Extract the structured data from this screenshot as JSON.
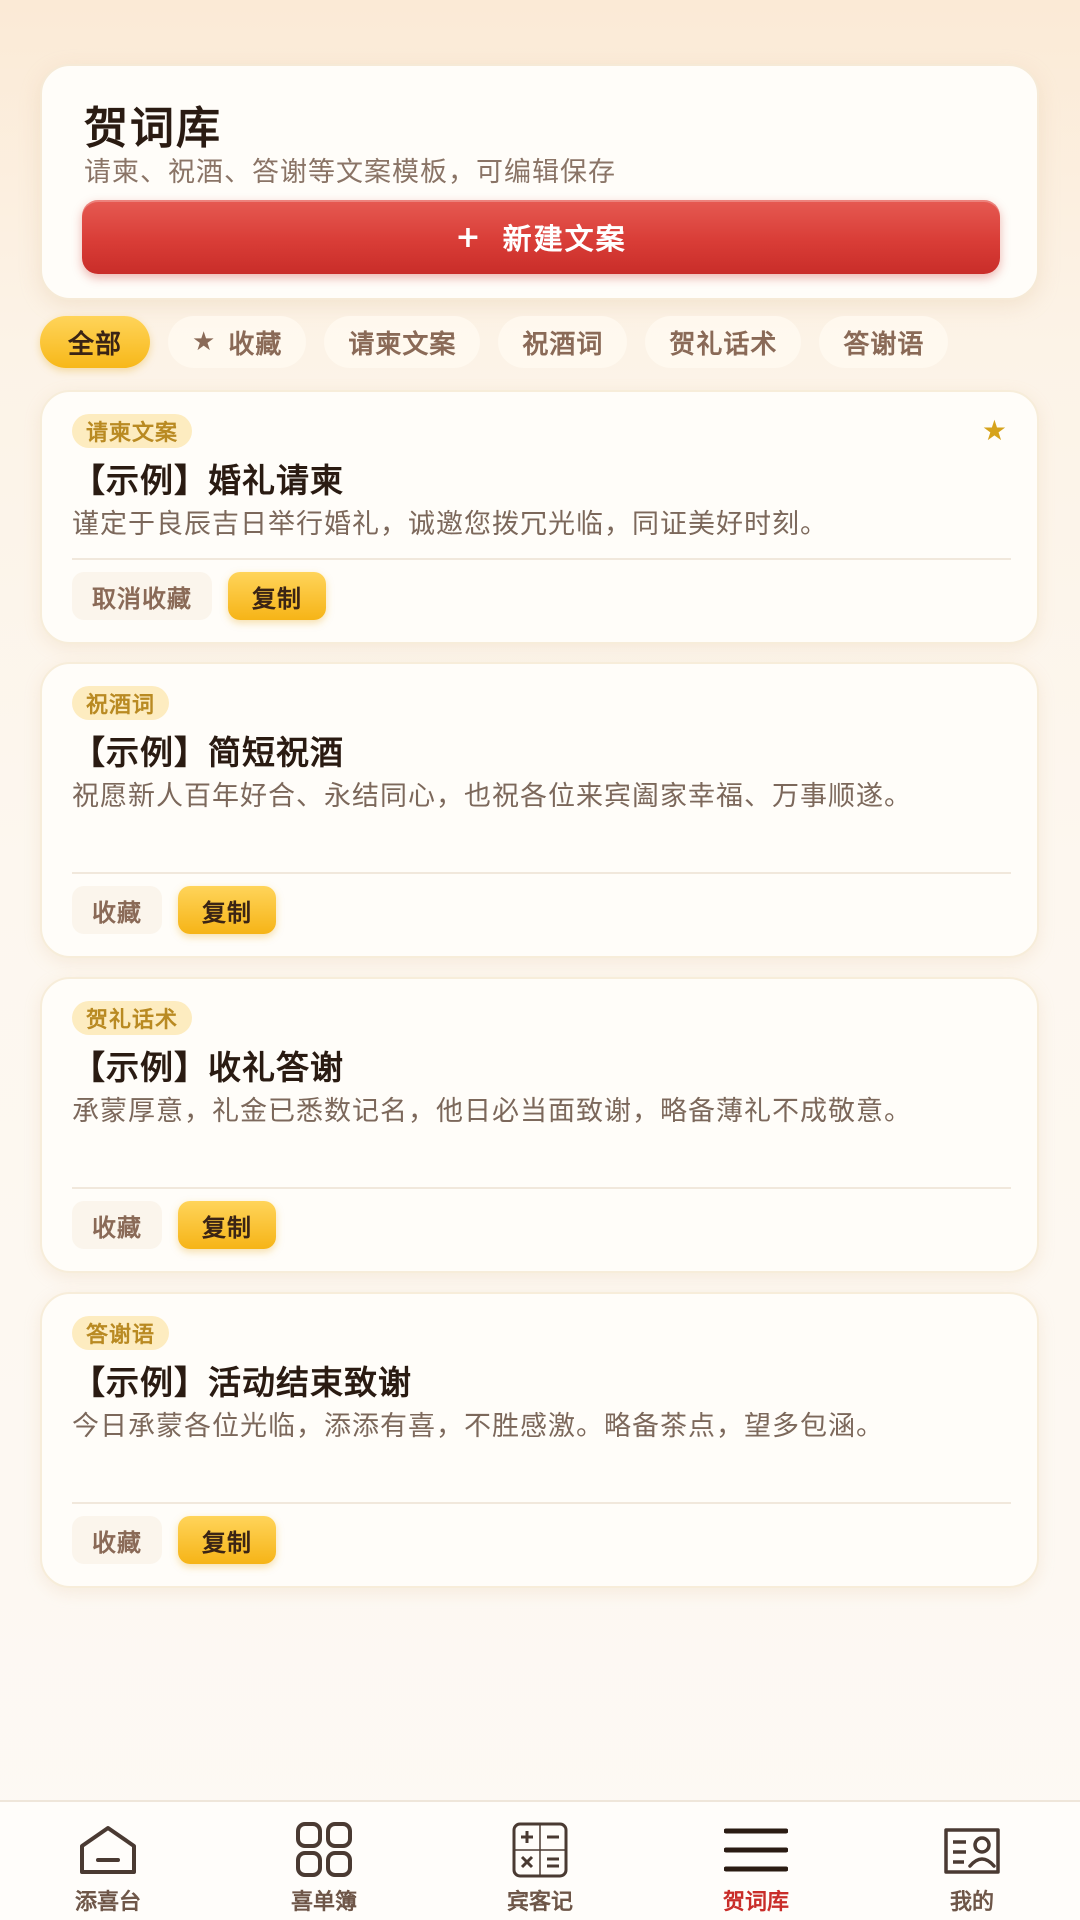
{
  "header": {
    "title": "贺词库",
    "subtitle": "请柬、祝酒、答谢等文案模板，可编辑保存",
    "new_button_icon": "+",
    "new_button_label": "新建文案"
  },
  "tabs": [
    {
      "label": "全部",
      "active": true
    },
    {
      "label": "收藏",
      "icon": "star-icon",
      "glyph": "★"
    },
    {
      "label": "请柬文案"
    },
    {
      "label": "祝酒词"
    },
    {
      "label": "贺礼话术"
    },
    {
      "label": "答谢语"
    }
  ],
  "cards": [
    {
      "tag": "请柬文案",
      "starred": true,
      "star_glyph": "★",
      "title": "【示例】婚礼请柬",
      "body": "谨定于良辰吉日举行婚礼，诚邀您拨冗光临，同证美好时刻。",
      "fav_label": "取消收藏",
      "copy_label": "复制"
    },
    {
      "tag": "祝酒词",
      "title": "【示例】简短祝酒",
      "body": "祝愿新人百年好合、永结同心，也祝各位来宾阖家幸福、万事顺遂。",
      "fav_label": "收藏",
      "copy_label": "复制"
    },
    {
      "tag": "贺礼话术",
      "title": "【示例】收礼答谢",
      "body": "承蒙厚意，礼金已悉数记名，他日必当面致谢，略备薄礼不成敬意。",
      "fav_label": "收藏",
      "copy_label": "复制"
    },
    {
      "tag": "答谢语",
      "title": "【示例】活动结束致谢",
      "body": "今日承蒙各位光临，添添有喜，不胜感激。略备茶点，望多包涵。",
      "fav_label": "收藏",
      "copy_label": "复制"
    }
  ],
  "nav": [
    {
      "label": "添喜台",
      "icon": "home-icon"
    },
    {
      "label": "喜单簿",
      "icon": "grid-icon"
    },
    {
      "label": "宾客记",
      "icon": "calculator-icon"
    },
    {
      "label": "贺词库",
      "icon": "menu-icon",
      "active": true
    },
    {
      "label": "我的",
      "icon": "profile-card-icon"
    }
  ],
  "colors": {
    "accent_red": "#d93d37",
    "accent_yellow": "#f7b819",
    "active_nav": "#c92d29"
  }
}
